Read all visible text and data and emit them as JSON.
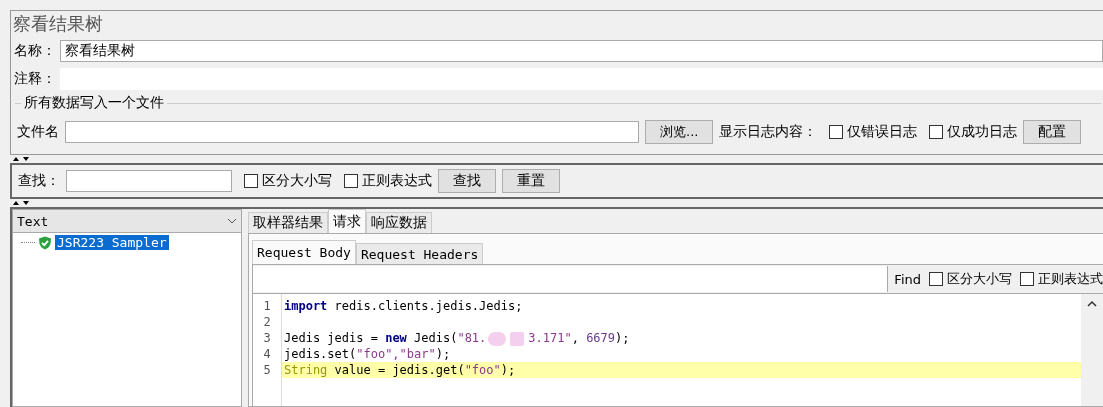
{
  "panel": {
    "title": "察看结果树"
  },
  "name_field": {
    "label": "名称：",
    "value": "察看结果树"
  },
  "comment_field": {
    "label": "注释："
  },
  "file_group": {
    "title": "所有数据写入一个文件",
    "file_label": "文件名",
    "browse_button": "浏览...",
    "log_label": "显示日志内容：",
    "checkboxes": [
      {
        "label": "仅错误日志",
        "checked": false
      },
      {
        "label": "仅成功日志",
        "checked": false
      }
    ],
    "config_button": "配置"
  },
  "search_bar": {
    "label": "查找：",
    "checkboxes": [
      {
        "label": "区分大小写",
        "checked": false
      },
      {
        "label": "正则表达式",
        "checked": false
      }
    ],
    "buttons": [
      "查找",
      "重置"
    ]
  },
  "renderer_select": {
    "value": "Text"
  },
  "tree": [
    {
      "label": "JSR223 Sampler",
      "selected": true,
      "passed": true
    }
  ],
  "tabs": [
    {
      "label": "取样器结果",
      "selected": false
    },
    {
      "label": "请求",
      "selected": true
    },
    {
      "label": "响应数据",
      "selected": false
    }
  ],
  "sub_tabs": [
    {
      "label": "Request Body",
      "selected": true
    },
    {
      "label": "Request Headers",
      "selected": false
    }
  ],
  "find_bar": {
    "label": "Find",
    "checkboxes": [
      {
        "label": "区分大小写",
        "checked": false
      },
      {
        "label": "正则表达式",
        "checked": false
      }
    ]
  },
  "code": {
    "lines": [
      {
        "number": "1",
        "highlighted": false,
        "tokens": [
          {
            "kind": "keyword",
            "text": "import"
          },
          {
            "kind": "plain",
            "text": " redis.clients.jedis.Jedis;"
          }
        ]
      },
      {
        "number": "2",
        "highlighted": false
      },
      {
        "number": "3",
        "highlighted": false,
        "tokens": [
          {
            "kind": "plain",
            "text": "Jedis jedis = "
          },
          {
            "kind": "keyword",
            "text": "new"
          },
          {
            "kind": "plain",
            "text": " Jedis("
          },
          {
            "kind": "string",
            "text": "\"81."
          },
          {
            "kind": "redacted"
          },
          {
            "kind": "string",
            "text": "3.171\""
          },
          {
            "kind": "plain",
            "text": ", "
          },
          {
            "kind": "number",
            "text": "6679"
          },
          {
            "kind": "plain",
            "text": ");"
          }
        ]
      },
      {
        "number": "4",
        "highlighted": false,
        "tokens": [
          {
            "kind": "plain",
            "text": "jedis.set("
          },
          {
            "kind": "string",
            "text": "\"foo\",\"bar\""
          },
          {
            "kind": "plain",
            "text": ");"
          }
        ]
      },
      {
        "number": "5",
        "highlighted": true,
        "tokens": [
          {
            "kind": "type",
            "text": "String"
          },
          {
            "kind": "plain",
            "text": " value = jedis.get("
          },
          {
            "kind": "string",
            "text": "\"foo\""
          },
          {
            "kind": "plain",
            "text": ");"
          }
        ]
      }
    ]
  }
}
